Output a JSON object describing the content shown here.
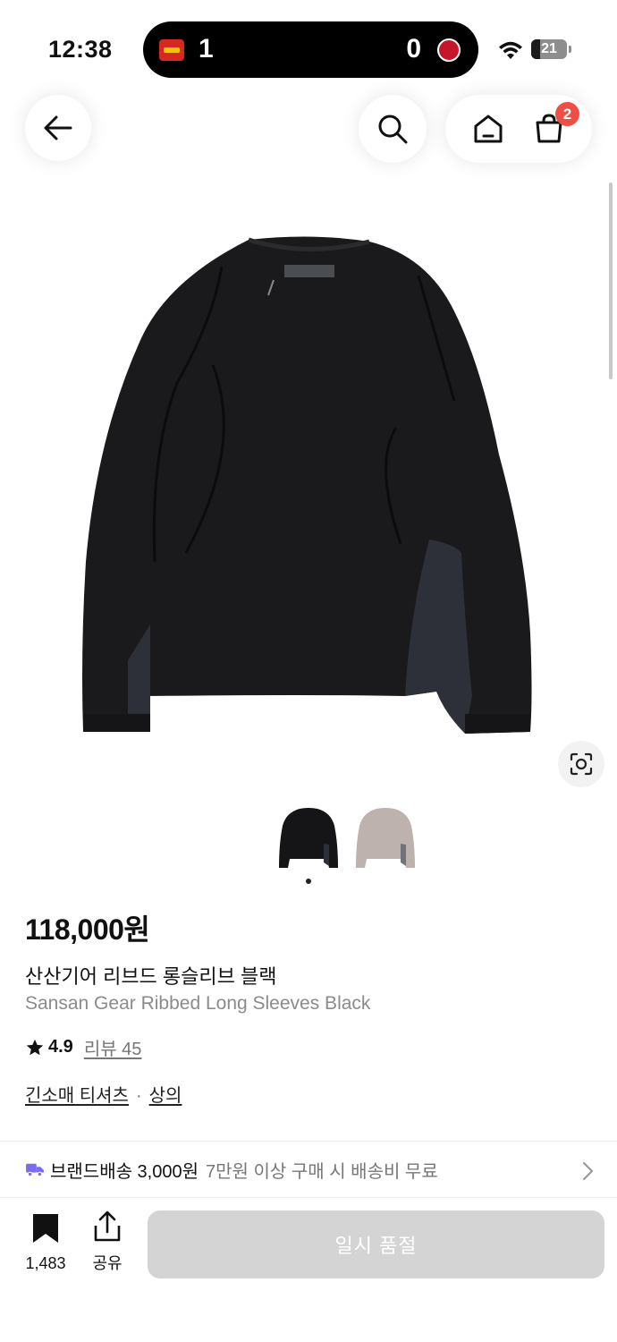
{
  "status_bar": {
    "time": "12:38",
    "score_left": "1",
    "score_right": "0",
    "battery": "21"
  },
  "header": {
    "cart_count": "2"
  },
  "product": {
    "price": "118,000원",
    "name_kr": "산산기어 리브드 롱슬리브 블랙",
    "name_en": "Sansan Gear Ribbed Long Sleeves Black",
    "rating": "4.9",
    "review_label": "리뷰 45",
    "category_1": "긴소매 티셔츠",
    "category_sep": "·",
    "category_2": "상의",
    "image_index": 1,
    "thumbnails": [
      "black-sweater",
      "grey-sweater"
    ]
  },
  "shipping": {
    "label": "브랜드배송 3,000원",
    "note": "7만원 이상 구매 시 배송비 무료"
  },
  "bottom_bar": {
    "bookmark_count": "1,483",
    "share_label": "공유",
    "buy_label": "일시 품절"
  },
  "colors": {
    "accent_badge": "#ee4e43",
    "truck": "#7a6cf0",
    "disabled_button": "#d4d4d4"
  },
  "icons": [
    "back-arrow-icon",
    "search-icon",
    "home-icon",
    "cart-icon",
    "lens-icon",
    "star-icon",
    "truck-icon",
    "chevron-right-icon",
    "bookmark-icon",
    "share-icon"
  ]
}
